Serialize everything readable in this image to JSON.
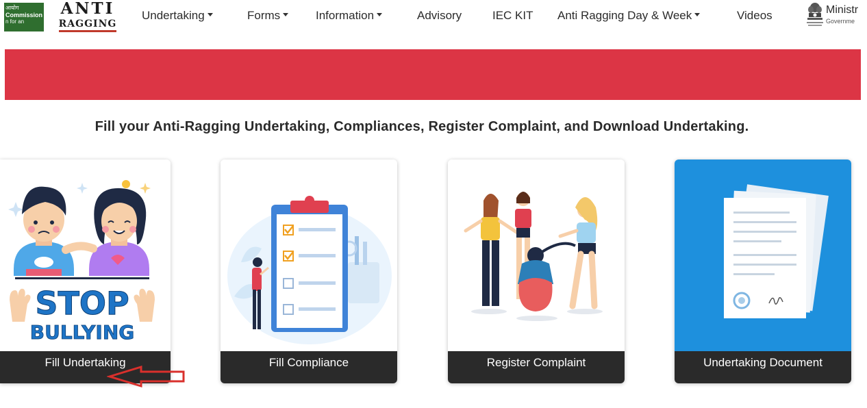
{
  "header": {
    "ugc_logo": {
      "line1": "आयोग",
      "line2": "Commission",
      "line3": "n for an"
    },
    "anti_ragging_logo": {
      "line1": "ANTI",
      "line2": "RAGGING"
    },
    "nav": [
      {
        "label": "Undertaking",
        "dropdown": true
      },
      {
        "label": "Forms",
        "dropdown": true
      },
      {
        "label": "Information",
        "dropdown": true
      },
      {
        "label": "Advisory",
        "dropdown": false
      },
      {
        "label": "IEC KIT",
        "dropdown": false
      },
      {
        "label": "Anti Ragging Day & Week",
        "dropdown": true
      },
      {
        "label": "Videos",
        "dropdown": false
      }
    ],
    "ministry": {
      "title": "Ministr",
      "subtitle": "Governme",
      "icon": "national-emblem-icon"
    }
  },
  "banner": {
    "color": "#dc3545"
  },
  "heading": "Fill your Anti-Ragging Undertaking, Compliances, Register Complaint, and Download Undertaking.",
  "cards": [
    {
      "label": "Fill Undertaking",
      "image": "stop-bullying-illustration",
      "image_text": {
        "line1": "STOP",
        "line2": "BULLYING"
      }
    },
    {
      "label": "Fill Compliance",
      "image": "clipboard-checklist-illustration"
    },
    {
      "label": "Register Complaint",
      "image": "ragging-victim-illustration"
    },
    {
      "label": "Undertaking Document",
      "image": "document-stack-illustration"
    }
  ],
  "annotation": {
    "icon": "red-arrow-icon",
    "color": "#d9302c"
  },
  "colors": {
    "card_footer": "#2a2a2a",
    "doc_card_bg": "#1e90dd",
    "accent_red": "#dc3545"
  }
}
